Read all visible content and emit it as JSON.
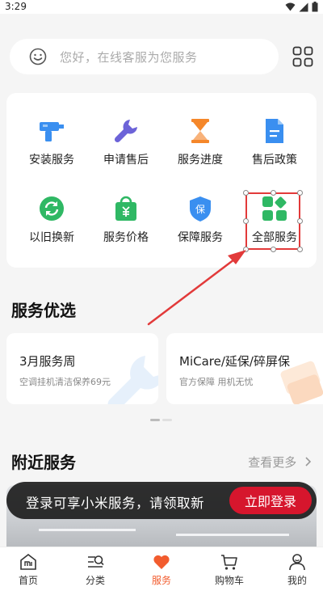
{
  "status_bar": {
    "time": "3:29"
  },
  "search": {
    "placeholder": "您好，在线客服为您服务"
  },
  "services": [
    {
      "label": "安装服务",
      "icon": "drill-icon"
    },
    {
      "label": "申请售后",
      "icon": "wrench-icon"
    },
    {
      "label": "服务进度",
      "icon": "hourglass-icon"
    },
    {
      "label": "售后政策",
      "icon": "document-icon"
    },
    {
      "label": "以旧换新",
      "icon": "refresh-icon"
    },
    {
      "label": "服务价格",
      "icon": "price-bag-icon"
    },
    {
      "label": "保障服务",
      "icon": "shield-icon"
    },
    {
      "label": "全部服务",
      "icon": "all-services-icon"
    }
  ],
  "featured": {
    "title": "服务优选",
    "cards": [
      {
        "title": "3月服务周",
        "subtitle": "空调挂机清洁保养69元"
      },
      {
        "title": "MiCare/延保/碎屏保",
        "subtitle": "官方保障 用机无忧"
      }
    ]
  },
  "nearby": {
    "title": "附近服务",
    "more_label": "查看更多"
  },
  "login_banner": {
    "text": "登录可享小米服务，请领取新",
    "button_label": "立即登录"
  },
  "tabs": [
    {
      "label": "首页",
      "icon": "mi-home-icon",
      "active": false
    },
    {
      "label": "分类",
      "icon": "category-icon",
      "active": false
    },
    {
      "label": "服务",
      "icon": "heart-icon",
      "active": true
    },
    {
      "label": "购物车",
      "icon": "cart-icon",
      "active": false
    },
    {
      "label": "我的",
      "icon": "profile-icon",
      "active": false
    }
  ],
  "colors": {
    "accent": "#f25c2e",
    "login_button": "#d6162d",
    "annotation": "#e23a3a",
    "icon_blue": "#3a8ff0",
    "icon_green": "#2fb864",
    "icon_orange": "#f5872a"
  }
}
